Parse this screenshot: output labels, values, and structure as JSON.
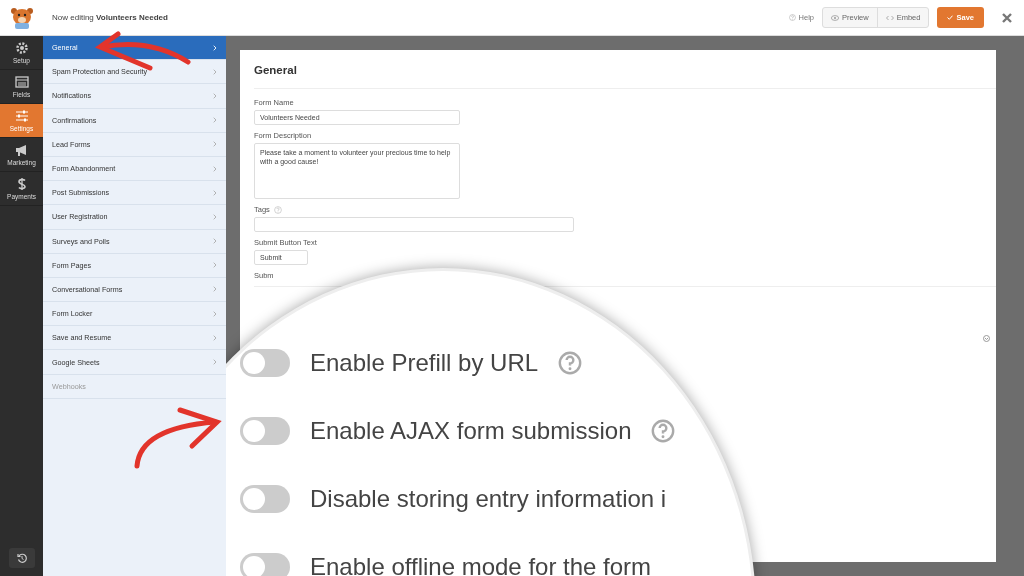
{
  "header": {
    "prefix": "Now editing",
    "form_name": "Volunteers Needed",
    "help": "Help",
    "preview": "Preview",
    "embed": "Embed",
    "save": "Save"
  },
  "nav": [
    {
      "label": "Setup",
      "selected": false
    },
    {
      "label": "Fields",
      "selected": false
    },
    {
      "label": "Settings",
      "selected": true
    },
    {
      "label": "Marketing",
      "selected": false
    },
    {
      "label": "Payments",
      "selected": false
    }
  ],
  "settings_menu": [
    {
      "label": "General",
      "selected": true,
      "disabled": false
    },
    {
      "label": "Spam Protection and Security",
      "selected": false,
      "disabled": false
    },
    {
      "label": "Notifications",
      "selected": false,
      "disabled": false
    },
    {
      "label": "Confirmations",
      "selected": false,
      "disabled": false
    },
    {
      "label": "Lead Forms",
      "selected": false,
      "disabled": false
    },
    {
      "label": "Form Abandonment",
      "selected": false,
      "disabled": false
    },
    {
      "label": "Post Submissions",
      "selected": false,
      "disabled": false
    },
    {
      "label": "User Registration",
      "selected": false,
      "disabled": false
    },
    {
      "label": "Surveys and Polls",
      "selected": false,
      "disabled": false
    },
    {
      "label": "Form Pages",
      "selected": false,
      "disabled": false
    },
    {
      "label": "Conversational Forms",
      "selected": false,
      "disabled": false
    },
    {
      "label": "Form Locker",
      "selected": false,
      "disabled": false
    },
    {
      "label": "Save and Resume",
      "selected": false,
      "disabled": false
    },
    {
      "label": "Google Sheets",
      "selected": false,
      "disabled": false
    },
    {
      "label": "Webhooks",
      "selected": false,
      "disabled": true
    }
  ],
  "panel": {
    "title": "General",
    "fields": [
      {
        "label": "Form Name",
        "kind": "input",
        "value": "Volunteers Needed",
        "help": false
      },
      {
        "label": "Form Description",
        "kind": "textarea",
        "value": "Please take a moment to volunteer your precious time to help with a good cause!",
        "help": false
      },
      {
        "label": "Tags",
        "kind": "wide-input",
        "help": true
      },
      {
        "label": "Submit Button Text",
        "kind": "cut-input",
        "value": "Submit",
        "help": false
      },
      {
        "label": "Subm",
        "kind": "label",
        "help": false
      }
    ]
  },
  "magnifier": {
    "toggles": [
      {
        "label": "Enable Prefill by URL",
        "on": false,
        "help": true
      },
      {
        "label": "Enable AJAX form submission",
        "on": false,
        "help": true
      },
      {
        "label": "Disable storing entry information i",
        "on": false,
        "help": false
      },
      {
        "label": "Enable offline mode for the form",
        "on": false,
        "help": false
      }
    ]
  }
}
